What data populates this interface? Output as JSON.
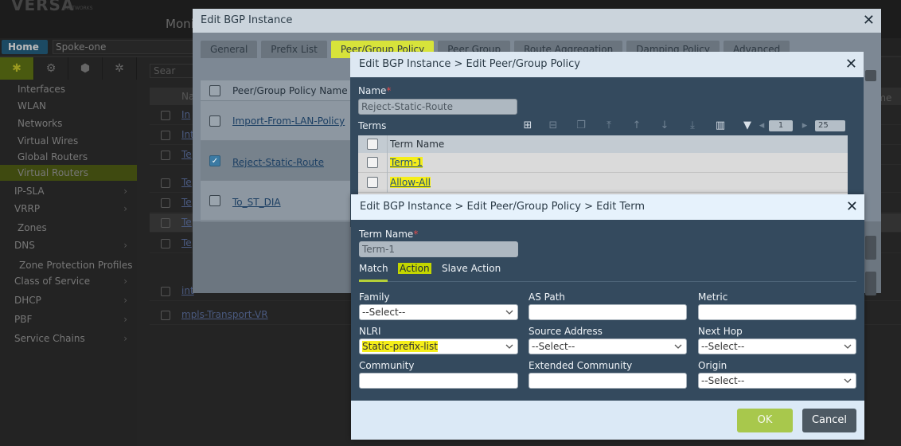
{
  "app": {
    "logo": "VERSA",
    "logo_sub": "NETWORKS",
    "monitor_tab": "Moni",
    "home_label": "Home",
    "org_value": "Spoke-one",
    "search_placeholder": "Sear"
  },
  "sidebar": {
    "items": [
      {
        "label": "Interfaces"
      },
      {
        "label": "WLAN"
      },
      {
        "label": "Networks"
      },
      {
        "label": "Virtual Wires"
      },
      {
        "label": "Global Routers"
      },
      {
        "label": "Virtual Routers"
      },
      {
        "label": "IP-SLA"
      },
      {
        "label": "VRRP"
      },
      {
        "label": "Zones"
      },
      {
        "label": "DNS"
      },
      {
        "label": "Zone Protection Profiles"
      },
      {
        "label": "Class of Service"
      },
      {
        "label": "DHCP"
      },
      {
        "label": "PBF"
      },
      {
        "label": "Service Chains"
      }
    ]
  },
  "background_table": {
    "header_name": "Na",
    "header_right": "ime",
    "rows": [
      "In",
      "Int",
      "Te",
      "Te",
      "Te",
      "Te",
      "Te",
      "int",
      "mpls-Transport-VR"
    ]
  },
  "dialog1": {
    "title": "Edit BGP Instance",
    "tabs": [
      "General",
      "Prefix List",
      "Peer/Group Policy",
      "Peer Group",
      "Route Aggregation",
      "Damping Policy",
      "Advanced"
    ],
    "table_header": "Peer/Group Policy Name",
    "rows": [
      "Import-From-LAN-Policy",
      "Reject-Static-Route",
      "To_ST_DIA"
    ]
  },
  "dialog2": {
    "title": "Edit BGP Instance > Edit Peer/Group Policy",
    "name_label": "Name",
    "name_value": "Reject-Static-Route",
    "terms_label": "Terms",
    "page_value": "1",
    "page_size": "25",
    "grid_header": "Term Name",
    "terms": [
      "Term-1",
      "Allow-All"
    ]
  },
  "dialog3": {
    "title": "Edit BGP Instance > Edit Peer/Group Policy > Edit Term",
    "term_name_label": "Term Name",
    "term_name_value": "Term-1",
    "tabs": [
      "Match",
      "Action",
      "Slave Action"
    ],
    "fields": {
      "family_label": "Family",
      "family_value": "--Select--",
      "as_path_label": "AS Path",
      "as_path_value": "",
      "metric_label": "Metric",
      "metric_value": "",
      "nlri_label": "NLRI",
      "nlri_value": "Static-prefix-list",
      "source_address_label": "Source Address",
      "source_address_value": "--Select--",
      "next_hop_label": "Next Hop",
      "next_hop_value": "--Select--",
      "community_label": "Community",
      "community_value": "",
      "extended_community_label": "Extended Community",
      "extended_community_value": "",
      "origin_label": "Origin",
      "origin_value": "--Select--"
    },
    "ok_label": "OK",
    "cancel_label": "Cancel"
  },
  "colors": {
    "highlight": "#f5ee19",
    "ok_button": "#a8c84c",
    "cancel_button": "#4d5963",
    "dialog_body": "#344a5e"
  }
}
